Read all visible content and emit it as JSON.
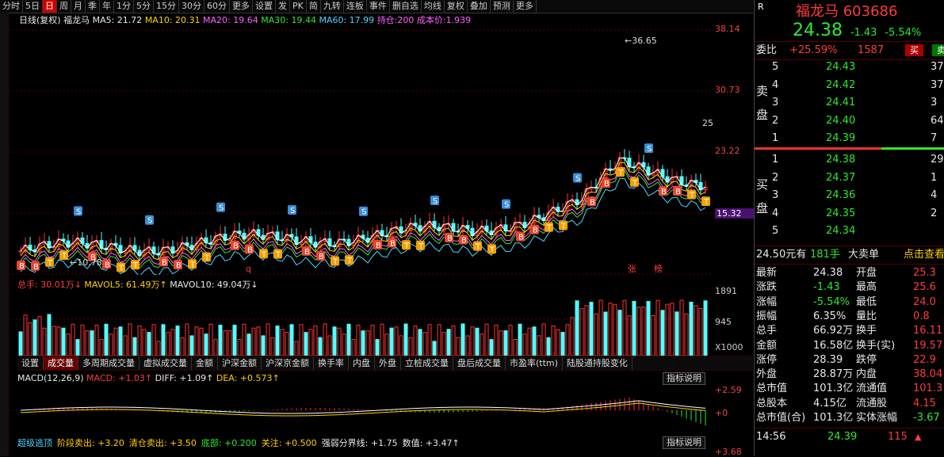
{
  "toolbar": {
    "items": [
      "分时",
      "5日",
      "日",
      "周",
      "月",
      "季",
      "年",
      "1分",
      "5分",
      "15分",
      "30分",
      "60分",
      "更多",
      "设置",
      "发",
      "PK",
      "简",
      "九转",
      "连板",
      "事件",
      "删自选",
      "均线",
      "复权",
      "叠加",
      "预测",
      "更多"
    ],
    "active_index": 2
  },
  "chart": {
    "period_label": "日线(复权)",
    "name": "福龙马",
    "ma5": "MA5: 21.72",
    "ma10": "MA10: 20.31",
    "ma20": "MA20: 19.64",
    "ma30": "MA30: 19.44",
    "ma60": "MA60: 17.99",
    "hold": "持仓:200 成本价:1.939",
    "y_labels": [
      "38.14",
      "30.73",
      "23.22",
      "15.32"
    ],
    "current_price_tag": "15.32",
    "high_mark": "36.65",
    "low_mark": "10.78",
    "right_mark": "25",
    "markers": {
      "zhang": "张",
      "bang": "榜",
      "q": "q"
    }
  },
  "volume": {
    "total": "总手: 30.01万↓",
    "mavol5": "MAVOL5: 61.49万↑",
    "mavol10": "MAVOL10: 49.04万↓",
    "y_labels": [
      "1891",
      "945"
    ],
    "unit": "X1000"
  },
  "vol_tabs": [
    "设置",
    "成交量",
    "多周期成交量",
    "虚拟成交量",
    "金额",
    "沪深金额",
    "沪深京金额",
    "换手率",
    "内盘",
    "外盘",
    "立桩成交量",
    "盘后成交量",
    "市盈率(ttm)",
    "陆股通持股变化"
  ],
  "macd": {
    "title": "MACD(12,26,9)",
    "macd": "MACD: +1.03↑",
    "diff": "DIFF: +1.09↑",
    "dea": "DEA: +0.573↑",
    "y_labels": [
      "+2.59",
      "+0"
    ],
    "explain": "指标说明"
  },
  "indicator3": {
    "items": [
      "超级逃顶",
      "阶段卖出: +3.20",
      "清仓卖出: +3.50",
      "底部: +0.200",
      "关注: +0.500",
      "强弱分界线: +1.75",
      "数值: +3.47↑"
    ],
    "explain": "指标说明",
    "y_label": "+3.68"
  },
  "right": {
    "r": "R",
    "name": "福龙马",
    "code": "603686",
    "price": "24.38",
    "change": "-1.43",
    "pct": "-5.54%",
    "weibi_label": "委比",
    "weibi": "+25.59%",
    "weicha": "1587",
    "buy_btn": "买",
    "sell_btn": "卖",
    "sell_label": "卖盘",
    "buy_label": "买盘",
    "asks": [
      {
        "lvl": "5",
        "p": "24.43",
        "v": "37"
      },
      {
        "lvl": "4",
        "p": "24.42",
        "v": "37"
      },
      {
        "lvl": "3",
        "p": "24.41",
        "v": "3"
      },
      {
        "lvl": "2",
        "p": "24.40",
        "v": "64"
      },
      {
        "lvl": "1",
        "p": "24.39",
        "v": "7"
      }
    ],
    "bids": [
      {
        "lvl": "1",
        "p": "24.38",
        "v": "29"
      },
      {
        "lvl": "2",
        "p": "24.37",
        "v": "1"
      },
      {
        "lvl": "3",
        "p": "24.36",
        "v": "4"
      },
      {
        "lvl": "4",
        "p": "24.35",
        "v": "2"
      },
      {
        "lvl": "5",
        "p": "24.34",
        "v": ""
      }
    ],
    "big_order": {
      "a": "24.50元有",
      "b": "181手",
      "c": "大卖单",
      "d": "点击查看"
    },
    "stats": [
      [
        "最新",
        "24.38",
        "开盘",
        "25.3"
      ],
      [
        "涨跌",
        "-1.43",
        "最高",
        "25.6"
      ],
      [
        "涨幅",
        "-5.54%",
        "最低",
        "24.0"
      ],
      [
        "振幅",
        "6.35%",
        "量比",
        "0.8"
      ],
      [
        "总手",
        "66.92万",
        "换手",
        "16.11"
      ],
      [
        "金额",
        "16.58亿",
        "换手(实)",
        "19.57"
      ],
      [
        "涨停",
        "28.39",
        "跌停",
        "22.9"
      ],
      [
        "外盘",
        "28.87万",
        "内盘",
        "38.04"
      ],
      [
        "总市值",
        "101.3亿",
        "流通值",
        "101.3"
      ],
      [
        "总股本",
        "4.15亿",
        "流通股",
        "4.15"
      ],
      [
        "总市值(合)",
        "101.3亿",
        "实体涨幅",
        "-3.67"
      ]
    ],
    "tick": {
      "time": "14:56",
      "price": "24.39",
      "vol": "115"
    }
  }
}
